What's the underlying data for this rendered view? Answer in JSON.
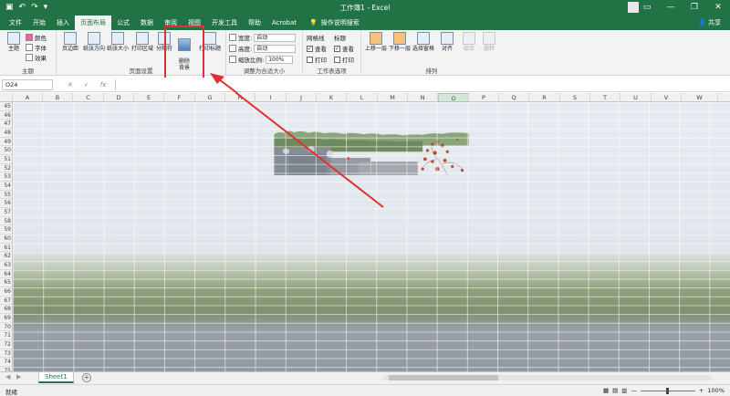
{
  "titlebar": {
    "title": "工作簿1 - Excel",
    "qa_icons": [
      "save-icon",
      "undo-icon",
      "redo-icon",
      "customize-icon"
    ],
    "window_buttons": [
      "—",
      "❐",
      "✕"
    ]
  },
  "tabs": {
    "items": [
      "文件",
      "开始",
      "插入",
      "页面布局",
      "公式",
      "数据",
      "审阅",
      "视图",
      "开发工具",
      "帮助",
      "Acrobat"
    ],
    "active": "页面布局",
    "tellme": "操作说明搜索",
    "share": "共享"
  },
  "ribbon": {
    "theme_group": {
      "label": "主题",
      "theme_btn": "主题",
      "colors": "颜色",
      "fonts": "字体",
      "effects": "效果"
    },
    "page_setup": {
      "label": "页面设置",
      "margins": "页边距",
      "orientation": "纸张方向",
      "size": "纸张大小",
      "print_area": "打印区域",
      "breaks": "分隔符",
      "background": "删除\n背景",
      "print_titles": "打印标题"
    },
    "scale_to_fit": {
      "label": "调整为合适大小",
      "width_label": "宽度:",
      "width_value": "自动",
      "height_label": "高度:",
      "height_value": "自动",
      "scale_label": "缩放比例:",
      "scale_value": "100%"
    },
    "sheet_options": {
      "label": "工作表选项",
      "gridlines": "网格线",
      "headings": "标题",
      "view": "查看",
      "print": "打印"
    },
    "arrange": {
      "label": "排列",
      "bring_forward": "上移一层",
      "send_backward": "下移一层",
      "selection_pane": "选择窗格",
      "align": "对齐",
      "group": "组合",
      "rotate": "旋转"
    }
  },
  "formula_bar": {
    "name_box": "O24",
    "cancel": "✕",
    "enter": "✓",
    "fx": "fx"
  },
  "columns": [
    "A",
    "B",
    "C",
    "D",
    "E",
    "F",
    "G",
    "H",
    "I",
    "J",
    "K",
    "L",
    "M",
    "N",
    "O",
    "P",
    "Q",
    "R",
    "S",
    "T",
    "U",
    "V",
    "W"
  ],
  "selected_column": "O",
  "rows": [
    "45",
    "46",
    "47",
    "48",
    "49",
    "50",
    "51",
    "52",
    "53",
    "54",
    "55",
    "56",
    "57",
    "58",
    "59",
    "60",
    "61",
    "62",
    "63",
    "64",
    "65",
    "66",
    "67",
    "68",
    "69",
    "70",
    "71",
    "72",
    "73",
    "74",
    "75"
  ],
  "sheet_tab": "Sheet1",
  "add_sheet": "+",
  "status": {
    "ready": "就绪",
    "zoom": "100%",
    "zoom_minus": "—",
    "zoom_plus": "+"
  },
  "colors": {
    "excel_green": "#217346",
    "highlight_red": "#e03030"
  }
}
